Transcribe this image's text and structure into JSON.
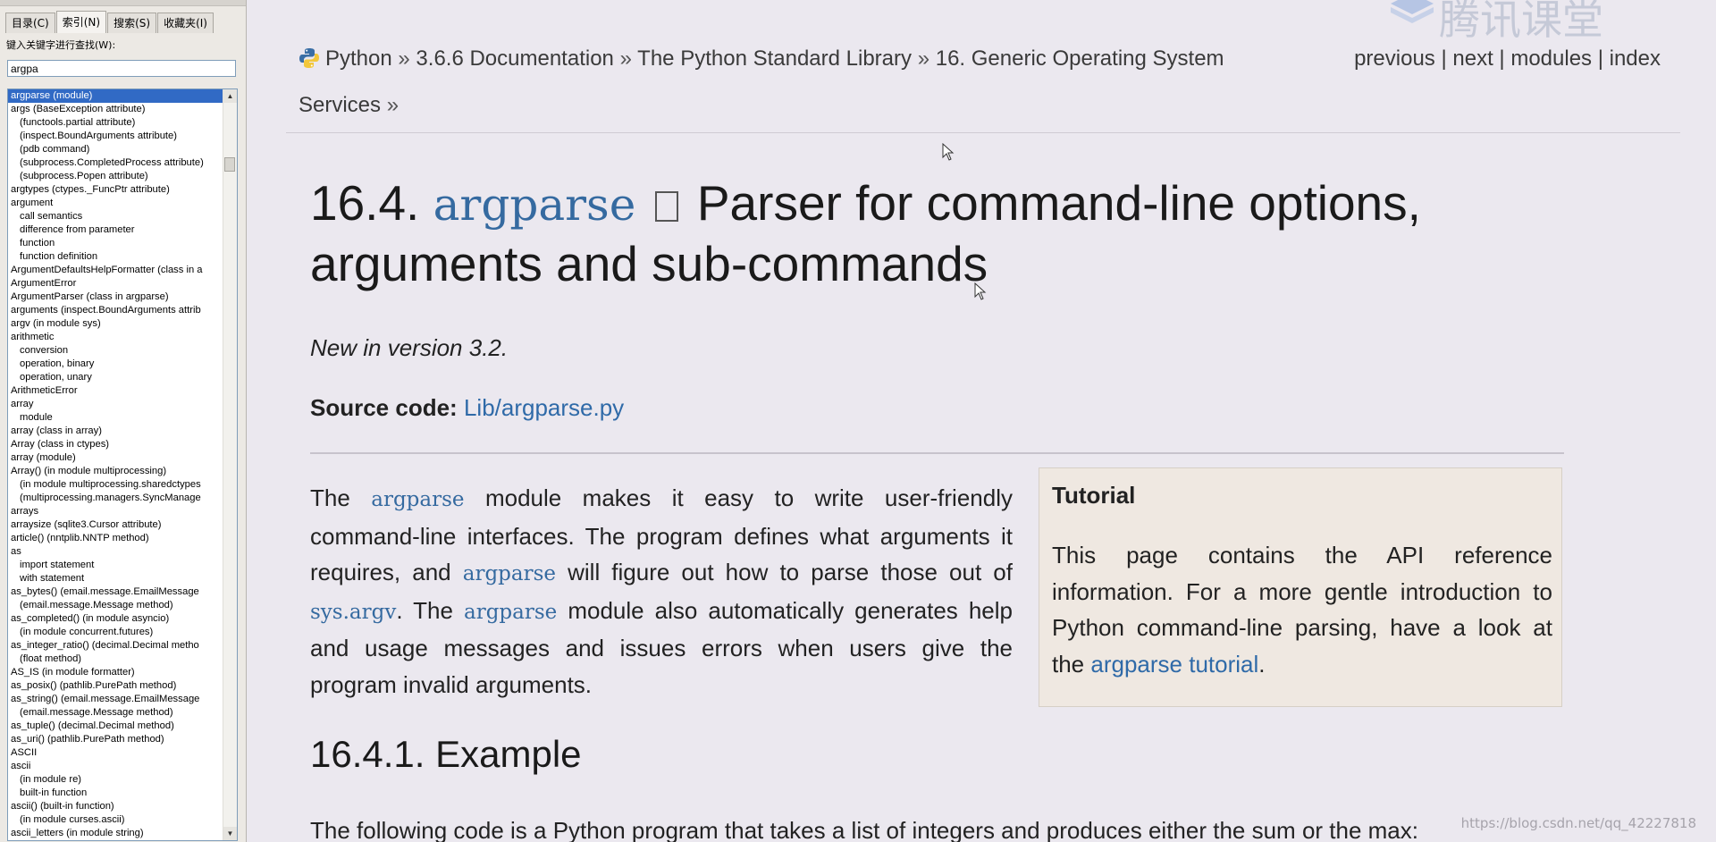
{
  "left_pane": {
    "tabs": [
      "目录(C)",
      "索引(N)",
      "搜索(S)",
      "收藏夹(I)"
    ],
    "keyword_label": "键入关键字进行查找(W):",
    "keyword_value": "argpa",
    "index_items": [
      {
        "text": "argparse (module)",
        "indent": false,
        "selected": true
      },
      {
        "text": "args (BaseException attribute)",
        "indent": false
      },
      {
        "text": "(functools.partial attribute)",
        "indent": true
      },
      {
        "text": "(inspect.BoundArguments attribute)",
        "indent": true
      },
      {
        "text": "(pdb command)",
        "indent": true
      },
      {
        "text": "(subprocess.CompletedProcess attribute)",
        "indent": true
      },
      {
        "text": "(subprocess.Popen attribute)",
        "indent": true
      },
      {
        "text": "argtypes (ctypes._FuncPtr attribute)",
        "indent": false
      },
      {
        "text": "argument",
        "indent": false
      },
      {
        "text": "call semantics",
        "indent": true
      },
      {
        "text": "difference from parameter",
        "indent": true
      },
      {
        "text": "function",
        "indent": true
      },
      {
        "text": "function definition",
        "indent": true
      },
      {
        "text": "ArgumentDefaultsHelpFormatter (class in a",
        "indent": false
      },
      {
        "text": "ArgumentError",
        "indent": false
      },
      {
        "text": "ArgumentParser (class in argparse)",
        "indent": false
      },
      {
        "text": "arguments (inspect.BoundArguments attrib",
        "indent": false
      },
      {
        "text": "argv (in module sys)",
        "indent": false
      },
      {
        "text": "arithmetic",
        "indent": false
      },
      {
        "text": "conversion",
        "indent": true
      },
      {
        "text": "operation, binary",
        "indent": true
      },
      {
        "text": "operation, unary",
        "indent": true
      },
      {
        "text": "ArithmeticError",
        "indent": false
      },
      {
        "text": "array",
        "indent": false
      },
      {
        "text": "module",
        "indent": true
      },
      {
        "text": "array (class in array)",
        "indent": false
      },
      {
        "text": "Array (class in ctypes)",
        "indent": false
      },
      {
        "text": "array (module)",
        "indent": false
      },
      {
        "text": "Array() (in module multiprocessing)",
        "indent": false
      },
      {
        "text": "(in module multiprocessing.sharedctypes",
        "indent": true
      },
      {
        "text": "(multiprocessing.managers.SyncManage",
        "indent": true
      },
      {
        "text": "arrays",
        "indent": false
      },
      {
        "text": "arraysize (sqlite3.Cursor attribute)",
        "indent": false
      },
      {
        "text": "article() (nntplib.NNTP method)",
        "indent": false
      },
      {
        "text": "as",
        "indent": false
      },
      {
        "text": "import statement",
        "indent": true
      },
      {
        "text": "with statement",
        "indent": true
      },
      {
        "text": "as_bytes() (email.message.EmailMessage",
        "indent": false
      },
      {
        "text": "(email.message.Message method)",
        "indent": true
      },
      {
        "text": "as_completed() (in module asyncio)",
        "indent": false
      },
      {
        "text": "(in module concurrent.futures)",
        "indent": true
      },
      {
        "text": "as_integer_ratio() (decimal.Decimal metho",
        "indent": false
      },
      {
        "text": "(float method)",
        "indent": true
      },
      {
        "text": "AS_IS (in module formatter)",
        "indent": false
      },
      {
        "text": "as_posix() (pathlib.PurePath method)",
        "indent": false
      },
      {
        "text": "as_string() (email.message.EmailMessage",
        "indent": false
      },
      {
        "text": "(email.message.Message method)",
        "indent": true
      },
      {
        "text": "as_tuple() (decimal.Decimal method)",
        "indent": false
      },
      {
        "text": "as_uri() (pathlib.PurePath method)",
        "indent": false
      },
      {
        "text": "ASCII",
        "indent": false
      },
      {
        "text": "ascii",
        "indent": false
      },
      {
        "text": "(in module re)",
        "indent": true
      },
      {
        "text": "built-in function",
        "indent": true
      },
      {
        "text": "ascii() (built-in function)",
        "indent": false
      },
      {
        "text": "(in module curses.ascii)",
        "indent": true
      },
      {
        "text": "ascii_letters (in module string)",
        "indent": false
      }
    ]
  },
  "watermark": "腾讯课堂",
  "nav": {
    "python": "Python",
    "sep": "»",
    "docs": "3.6.6 Documentation",
    "stdlib": "The Python Standard Library",
    "section": "16. Generic Operating System",
    "section_cont": "Services",
    "previous": "previous",
    "next": "next",
    "modules": "modules",
    "index": "index",
    "pipe": "|"
  },
  "title": {
    "number": "16.4.",
    "module": "argparse",
    "rest_line1": "Parser for command-line options,",
    "rest_line2": "arguments and sub-commands"
  },
  "new_in_version": "New in version 3.2.",
  "source": {
    "label": "Source code:",
    "link": "Lib/argparse.py"
  },
  "paragraph": {
    "t1": "The",
    "c1": "argparse",
    "t2": "module makes it easy to write user-friendly command-line interfaces. The program defines what arguments it requires, and",
    "c2": "argparse",
    "t3": "will figure out how to parse those out of",
    "c3": "sys.argv",
    "t4": ". The",
    "c4": "argparse",
    "t5": "module also automatically generates help and usage messages and issues errors when users give the program invalid arguments."
  },
  "tutorial": {
    "title": "Tutorial",
    "body_pre": "This page contains the API reference information. For a more gentle introduction to Python command-line parsing, have a look at the",
    "link": "argparse tutorial",
    "body_post": "."
  },
  "example_heading": "16.4.1. Example",
  "bottom_text": "The following code is a Python program that takes a list of integers and produces either the sum or the max:",
  "csdn_watermark": "https://blog.csdn.net/qq_42227818",
  "colors": {
    "link": "#2f6aa8",
    "code": "#356aa0",
    "selection": "#316ac5",
    "tutorial_bg": "#efe8e1"
  }
}
